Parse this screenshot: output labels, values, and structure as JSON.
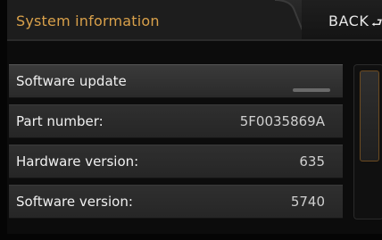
{
  "header": {
    "title": "System information",
    "back_label": "BACK",
    "back_icon": "⮐"
  },
  "rows": [
    {
      "label": "Software update",
      "value": ""
    },
    {
      "label": "Part number:",
      "value": "5F0035869A"
    },
    {
      "label": "Hardware version:",
      "value": "635"
    },
    {
      "label": "Software version:",
      "value": "5740"
    }
  ],
  "colors": {
    "title": "#d8a04a",
    "row_bg": "#2f2f2f",
    "scroll_accent": "#6c4b21"
  }
}
